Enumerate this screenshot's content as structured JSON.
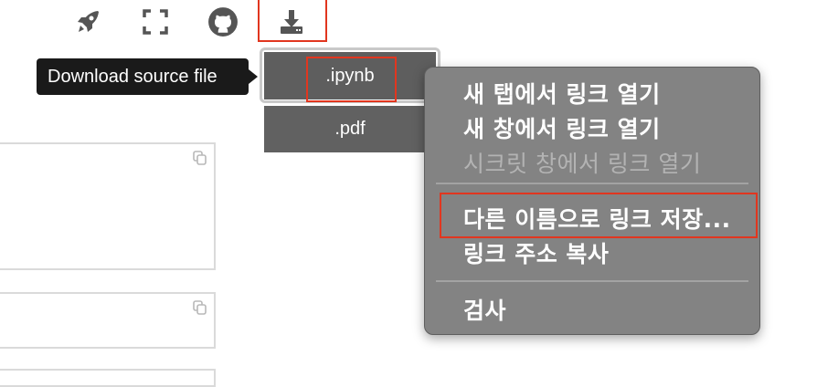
{
  "toolbar": {
    "icons": [
      "rocket-icon",
      "fullscreen-icon",
      "github-icon",
      "download-icon"
    ]
  },
  "tooltip": {
    "text": "Download source file"
  },
  "download_menu": {
    "items": [
      {
        "label": ".ipynb"
      },
      {
        "label": ".pdf"
      }
    ]
  },
  "context_menu": {
    "groups": [
      [
        {
          "label": "새 탭에서 링크 열기",
          "enabled": true
        },
        {
          "label": "새 창에서 링크 열기",
          "enabled": true
        },
        {
          "label": "시크릿 창에서 링크 열기",
          "enabled": false
        }
      ],
      [
        {
          "label": "다른 이름으로 링크 저장...",
          "enabled": true
        },
        {
          "label": "링크 주소 복사",
          "enabled": true
        }
      ],
      [
        {
          "label": "검사",
          "enabled": true
        }
      ]
    ]
  },
  "colors": {
    "highlight": "#e1361f",
    "menu_bg": "#838383",
    "dropdown_bg": "#616161",
    "tooltip_bg": "#1a1a1a"
  }
}
